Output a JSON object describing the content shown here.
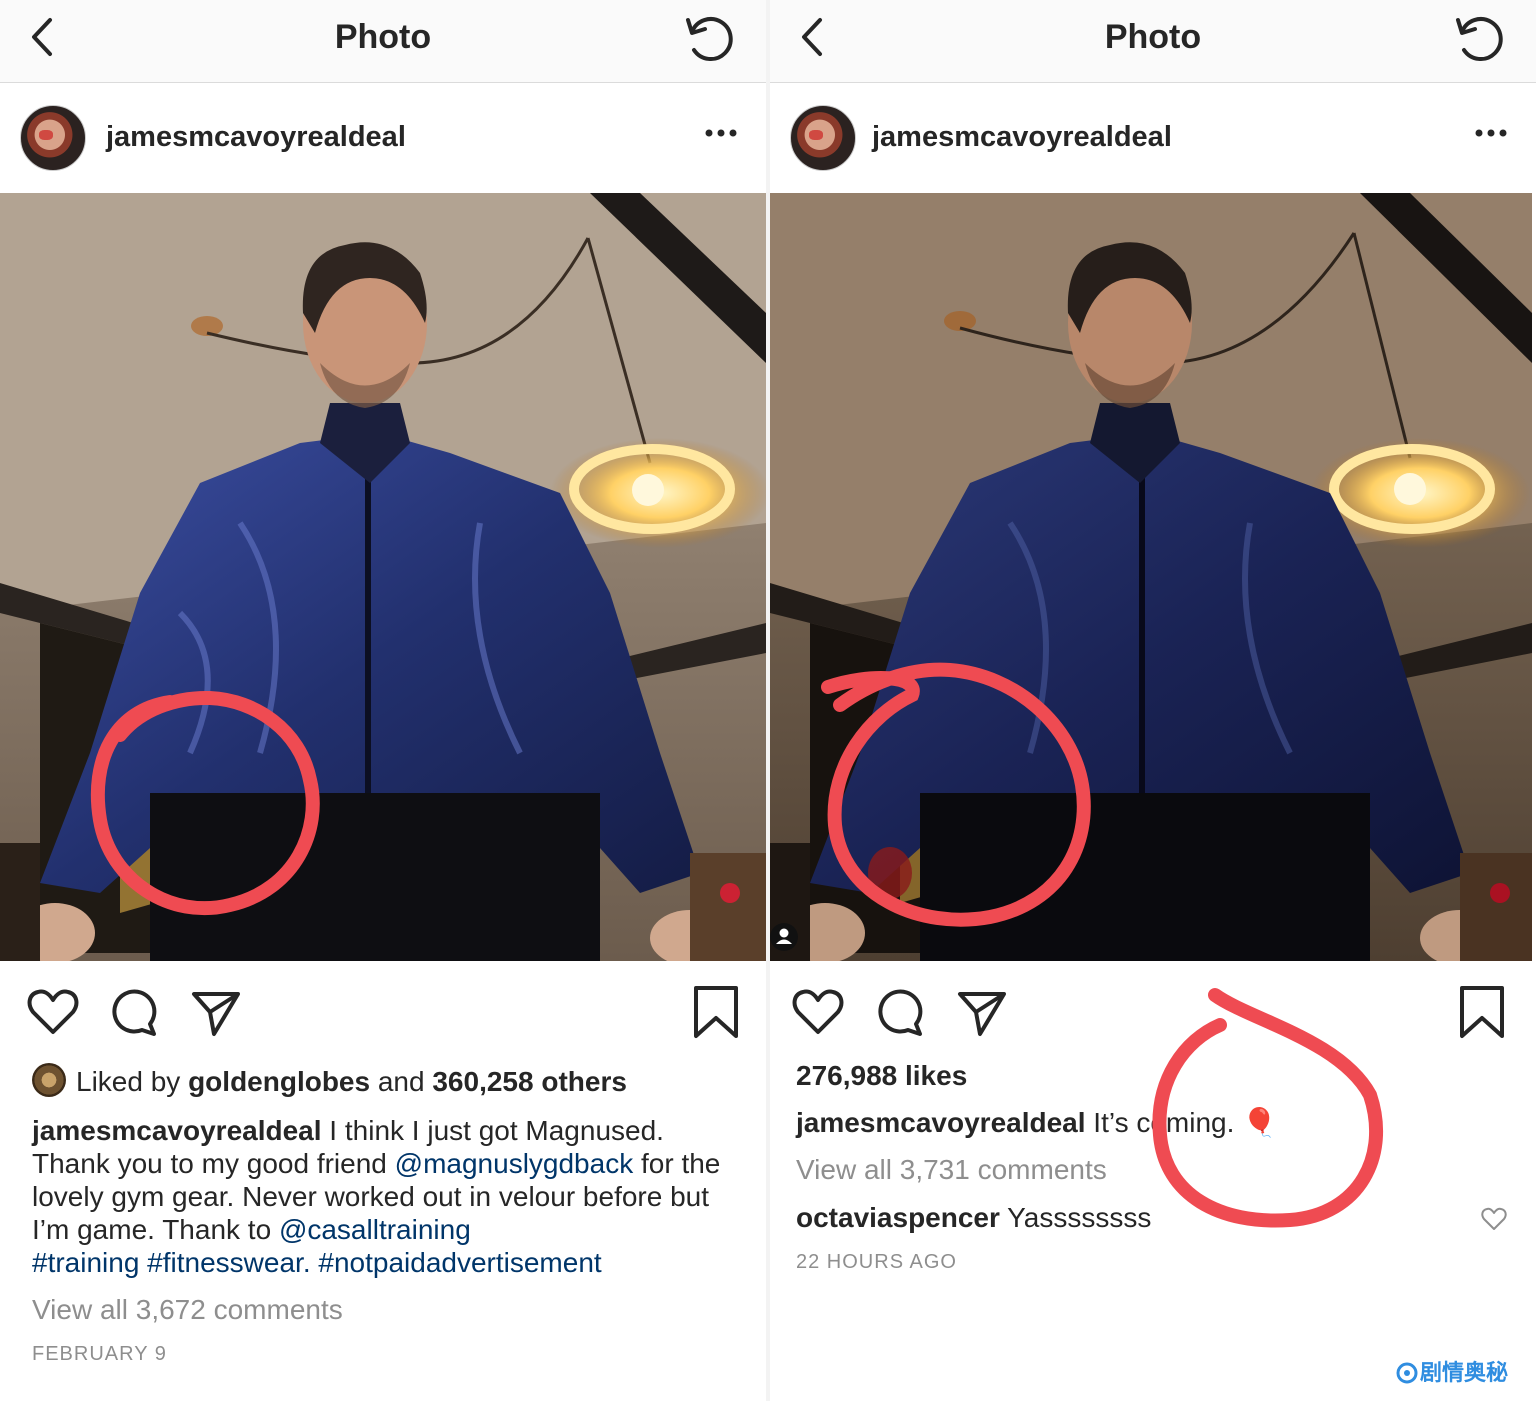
{
  "left": {
    "topbar": {
      "title": "Photo"
    },
    "post": {
      "username": "jamesmcavoyrealdeal",
      "liked_prefix": "Liked by",
      "liked_user": "goldenglobes",
      "liked_and": "and",
      "liked_others": "360,258 others",
      "caption_user": "jamesmcavoyrealdeal",
      "caption_1": " I think I just got Magnused. Thank you to my good friend ",
      "mention_1": "@magnuslygdback",
      "caption_2": " for the lovely gym gear. Never worked out in velour before but I’m game. Thank to ",
      "mention_2": "@casalltraining",
      "hashtags": "#training #fitnesswear. #notpaidadvertisement",
      "view_comments": "View all 3,672 comments",
      "date": "FEBRUARY 9"
    }
  },
  "right": {
    "topbar": {
      "title": "Photo"
    },
    "post": {
      "username": "jamesmcavoyrealdeal",
      "likes": "276,988 likes",
      "caption_user": "jamesmcavoyrealdeal",
      "caption_text": " It’s coming.",
      "caption_emoji": "🎈",
      "view_comments": "View all 3,731 comments",
      "comment_user": "octaviaspencer",
      "comment_text": " Yassssssss",
      "time": "22 HOURS AGO"
    }
  },
  "watermark": {
    "text": "剧情奥秘"
  },
  "colors": {
    "annotation": "#ef4b52",
    "link": "#003569",
    "muted": "#8e8e8e",
    "text": "#262626"
  },
  "icons": [
    "back-icon",
    "refresh-icon",
    "more-icon",
    "heart-icon",
    "comment-icon",
    "share-icon",
    "bookmark-icon",
    "user-tag-icon"
  ]
}
